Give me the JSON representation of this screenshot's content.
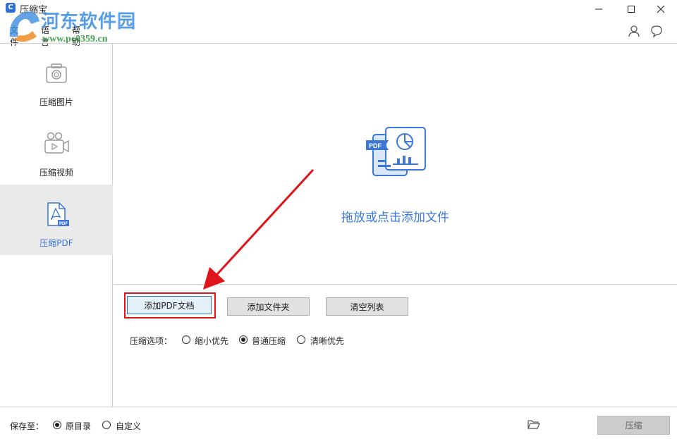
{
  "window": {
    "title": "压缩宝",
    "logo_letter": "C"
  },
  "watermark": {
    "title": "河东软件园",
    "url": "www.pc0359.cn"
  },
  "menu": {
    "file": "文件",
    "language": "语言",
    "help": "帮助"
  },
  "sidebar": {
    "items": [
      {
        "label": "压缩图片",
        "icon": "camera-icon",
        "active": false
      },
      {
        "label": "压缩视频",
        "icon": "video-camera-icon",
        "active": false
      },
      {
        "label": "压缩PDF",
        "icon": "pdf-file-icon",
        "active": true
      }
    ]
  },
  "dropzone": {
    "text": "拖放或点击添加文件",
    "icon": "pdf-documents-icon",
    "icon_badge": "PDF"
  },
  "toolbar": {
    "add_pdf": "添加PDF文档",
    "add_folder": "添加文件夹",
    "clear_list": "清空列表"
  },
  "options": {
    "label": "压缩选项：",
    "choices": [
      {
        "label": "缩小优先",
        "checked": false
      },
      {
        "label": "普通压缩",
        "checked": true
      },
      {
        "label": "清晰优先",
        "checked": false
      }
    ]
  },
  "footer": {
    "save_label": "保存至：",
    "choices": [
      {
        "label": "原目录",
        "checked": true
      },
      {
        "label": "自定义",
        "checked": false
      }
    ],
    "compress_button": "压缩"
  },
  "colors": {
    "accent": "#3b78d8",
    "highlight": "#e0141b"
  }
}
